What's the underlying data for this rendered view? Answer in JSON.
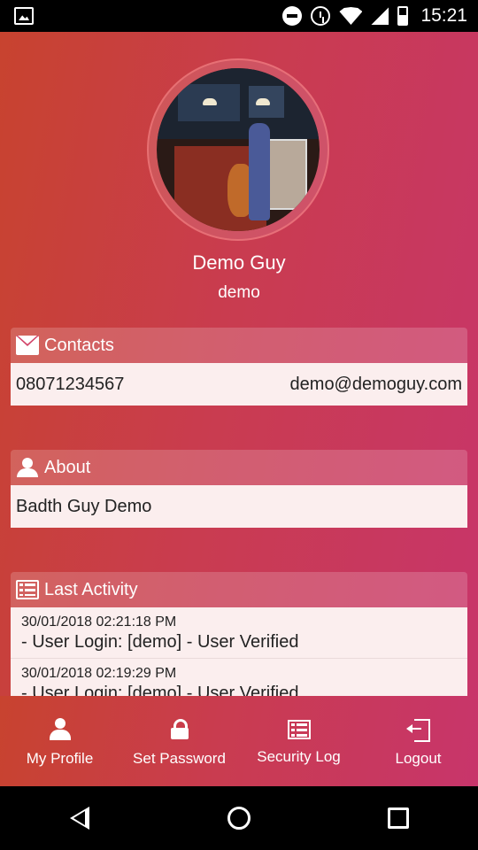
{
  "status_bar": {
    "time": "15:21",
    "icons": [
      "image-icon",
      "dnd-icon",
      "alarm-icon",
      "wifi-icon",
      "signal-icon",
      "battery-icon"
    ]
  },
  "profile": {
    "name": "Demo Guy",
    "username": "demo"
  },
  "contacts": {
    "title": "Contacts",
    "phone": "08071234567",
    "email": "demo@demoguy.com"
  },
  "about": {
    "title": "About",
    "text": "Badth Guy Demo"
  },
  "activity": {
    "title": "Last Activity",
    "items": [
      {
        "date": "30/01/2018 02:21:18 PM",
        "text": "- User Login: [demo] - User Verified"
      },
      {
        "date": "30/01/2018 02:19:29 PM",
        "text": "- User Login: [demo] - User Verified"
      }
    ]
  },
  "bottom_nav": {
    "items": [
      {
        "label": "My Profile",
        "icon": "user-icon"
      },
      {
        "label": "Set Password",
        "icon": "lock-icon"
      },
      {
        "label": "Security Log",
        "icon": "list-icon"
      },
      {
        "label": "Logout",
        "icon": "logout-icon"
      }
    ]
  },
  "colors": {
    "gradient_start": "#c8432f",
    "gradient_end": "#c8356b",
    "card_body": "#fbeeee"
  }
}
